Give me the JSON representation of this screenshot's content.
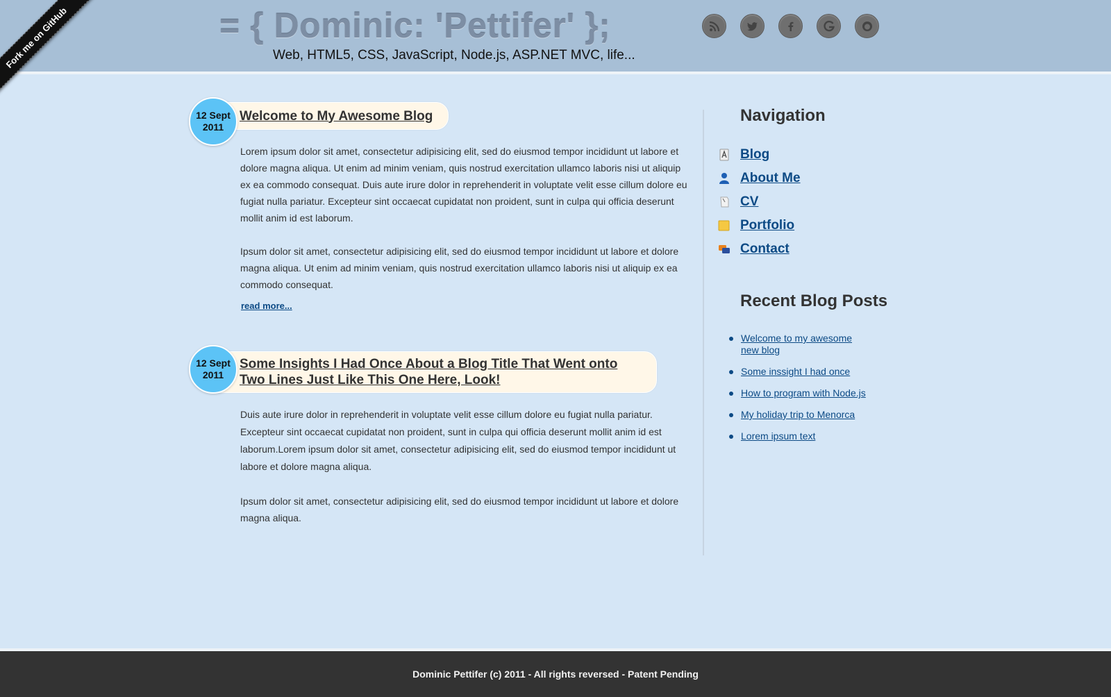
{
  "ribbon": {
    "label": "Fork me on GitHub"
  },
  "header": {
    "title": "= { Dominic: 'Pettifer' };",
    "tagline": "Web, HTML5, CSS, JavaScript, Node.js, ASP.NET MVC, life...",
    "social_icons": [
      "rss-icon",
      "twitter-icon",
      "facebook-icon",
      "google-icon",
      "github-icon"
    ]
  },
  "posts": [
    {
      "date_day": "12 Sept",
      "date_year": "2011",
      "title": "Welcome to My Awesome Blog",
      "paragraphs": [
        "Lorem ipsum dolor sit amet, consectetur adipisicing elit, sed do eiusmod tempor incididunt ut labore et dolore magna aliqua. Ut enim ad minim veniam, quis nostrud exercitation ullamco laboris nisi ut aliquip ex ea commodo consequat. Duis aute irure dolor in reprehenderit in voluptate velit esse cillum dolore eu fugiat nulla pariatur. Excepteur sint occaecat cupidatat non proident, sunt in culpa qui officia deserunt mollit anim id est laborum.",
        "Ipsum dolor sit amet, consectetur adipisicing elit, sed do eiusmod tempor incididunt ut labore et dolore magna aliqua. Ut enim ad minim veniam, quis nostrud exercitation ullamco laboris nisi ut aliquip ex ea commodo consequat."
      ],
      "read_more": "read more..."
    },
    {
      "date_day": "12 Sept",
      "date_year": "2011",
      "title": "Some Insights I Had Once About a Blog Title That Went onto Two Lines Just Like This One Here, Look!",
      "paragraphs": [
        "Duis aute irure dolor in reprehenderit in voluptate velit esse cillum dolore eu fugiat nulla pariatur. Excepteur sint occaecat cupidatat non proident, sunt in culpa qui officia deserunt mollit anim id est laborum.Lorem ipsum dolor sit amet, consectetur adipisicing elit, sed do eiusmod tempor incididunt ut labore et dolore magna aliqua.",
        "Ipsum dolor sit amet, consectetur adipisicing elit, sed do eiusmod tempor incididunt ut labore et dolore magna aliqua."
      ]
    }
  ],
  "sidebar": {
    "nav_heading": "Navigation",
    "nav_items": [
      {
        "label": "Blog",
        "icon": "pen-document-icon"
      },
      {
        "label": "About Me",
        "icon": "person-icon"
      },
      {
        "label": "CV",
        "icon": "scroll-icon"
      },
      {
        "label": "Portfolio",
        "icon": "folder-icon"
      },
      {
        "label": "Contact",
        "icon": "chat-bubbles-icon"
      }
    ],
    "recent_heading": "Recent Blog Posts",
    "recent_posts": [
      "Welcome to my awesome new blog",
      "Some inssight I had once",
      "How to program with Node.js",
      "My holiday trip to Menorca",
      "Lorem ipsum text"
    ]
  },
  "footer": {
    "text": "Dominic Pettifer (c) 2011 - All rights reversed - Patent Pending"
  },
  "colors": {
    "page_bg": "#d5e6f6",
    "header_bg": "#a7bfd6",
    "date_badge": "#5cc3f6",
    "title_pill": "#fff7e8",
    "link": "#0c4a85",
    "footer_bg": "#333333"
  }
}
